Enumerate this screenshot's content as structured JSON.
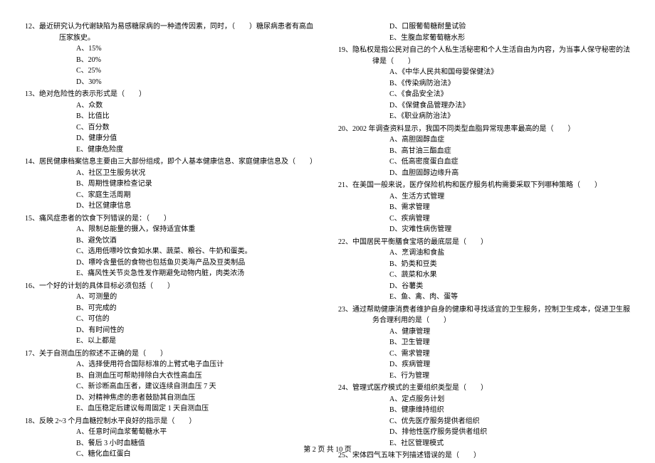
{
  "footer": "第 2 页 共 10 页",
  "left": {
    "q12": {
      "line1": "12、最近研究认为代谢缺陷为易感糖尿病的一种遗传因素，同时，（　　）糖尿病患者有高血",
      "line2": "压家族史。",
      "opts": [
        "A、15%",
        "B、20%",
        "C、25%",
        "D、30%"
      ]
    },
    "q13": {
      "text": "13、绝对危险性的表示形式是（　　）",
      "opts": [
        "A、众数",
        "B、比值比",
        "C、百分数",
        "D、健康分值",
        "E、健康危险度"
      ]
    },
    "q14": {
      "text": "14、居民健康档案信息主要由三大部份组成，即个人基本健康信息、家庭健康信息及（　　）",
      "opts": [
        "A、社区卫生服务状况",
        "B、周期性健康检查记录",
        "C、家庭生活周期",
        "D、社区健康信息"
      ]
    },
    "q15": {
      "text": "15、痛风症患者的饮食下列错误的是：（　　）",
      "opts": [
        "A、限制总能量的摄入，保持适宜体重",
        "B、避免饮酒",
        "C、选用低嘌呤饮食如水果、蔬菜、粮谷、牛奶和蛋类。",
        "D、嘌呤含量低的食物也包括鱼贝类海产品及豆类制品",
        "E、痛风性关节炎急性发作期避免动物内脏，肉类浓汤"
      ]
    },
    "q16": {
      "text": "16、一个好的计划的具体目标必须包括（　　）",
      "opts": [
        "A、可测量的",
        "B、可完成的",
        "C、可信的",
        "D、有时间性的",
        "E、以上都是"
      ]
    },
    "q17": {
      "text": "17、关于自测血压的叙述不正确的是（　　）",
      "opts": [
        "A、选择使用符合国际标准的上臂式电子血压计",
        "B、自测血压可帮助排除白大衣性高血压",
        "C、新诊断高血压者，建议连续自测血压 7 天",
        "D、对精神焦虑的患者鼓励其自测血压",
        "E、血压稳定后建议每周固定 1 天自测血压"
      ]
    },
    "q18": {
      "text": "18、反映 2~3 个月血糖控制水平良好的指示是（　　）",
      "opts": [
        "A、任意时间血浆葡萄糖水平",
        "B、餐后 3 小时血糖值",
        "C、糖化血红蛋白"
      ]
    }
  },
  "right": {
    "q18cont": {
      "opts": [
        "D、口服葡萄糖耐量试验",
        "E、生腹血浆葡萄糖水形"
      ]
    },
    "q19": {
      "line1": "19、隐私权是指公民对自己的个人私生活秘密和个人生活自由为内容，为当事人保守秘密的法",
      "line2": "律是（　　）",
      "opts": [
        "A、《中华人民共和国母婴保健法》",
        "B、《传染病防治法》",
        "C、《食品安全法》",
        "D、《保健食品管理办法》",
        "E、《职业病防治法》"
      ]
    },
    "q20": {
      "text": "20、2002 年调查资料显示，我国不同类型血脂异常现患率最高的是（　　）",
      "opts": [
        "A、高胆固醇血症",
        "B、高甘油三酯血症",
        "C、低高密度蛋白血症",
        "D、血胆固醇边缘升高"
      ]
    },
    "q21": {
      "text": "21、在美国一般来说，医疗保险机构和医疗服务机构需要采取下列哪种策略（　　）",
      "opts": [
        "A、生活方式管理",
        "B、需求管理",
        "C、疾病管理",
        "D、灾难性病伤管理"
      ]
    },
    "q22": {
      "text": "22、中国居民平衡膳食宝塔的最底层是（　　）",
      "opts": [
        "A、烹调油和食盐",
        "B、奶类和豆类",
        "C、蔬菜和水果",
        "D、谷薯类",
        "E、鱼、禽、肉、蛋等"
      ]
    },
    "q23": {
      "line1": "23、通过帮助健康消费者维护自身的健康和寻找适宜的卫生服务，控制卫生成本，促进卫生服",
      "line2": "务合理利用的是（　　）",
      "opts": [
        "A、健康管理",
        "B、卫生管理",
        "C、需求管理",
        "D、疾病管理",
        "E、行为管理"
      ]
    },
    "q24": {
      "text": "24、管理式医疗模式的主要组织类型是（　　）",
      "opts": [
        "A、定点服务计划",
        "B、健康维持组织",
        "C、优先医疗服务提供者组织",
        "D、排他性医疗服务提供者组织",
        "E、社区管理模式"
      ]
    },
    "q25": {
      "text": "25、宋体四气五味下列描述错误的是（　　）"
    }
  }
}
